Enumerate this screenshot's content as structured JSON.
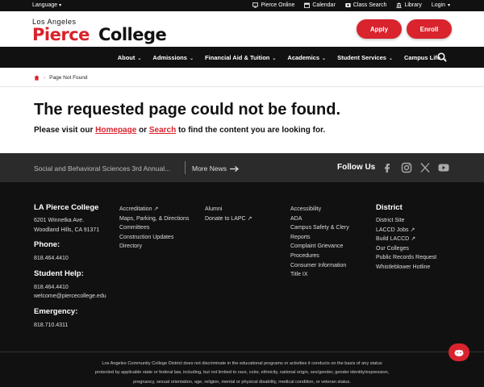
{
  "topbar": {
    "language": "Language",
    "links": [
      {
        "label": "Pierce Online",
        "icon": "monitor-icon"
      },
      {
        "label": "Calendar",
        "icon": "calendar-icon"
      },
      {
        "label": "Class Search",
        "icon": "class-search-icon"
      },
      {
        "label": "Library",
        "icon": "library-icon"
      },
      {
        "label": "Login",
        "icon": "chevron-down-icon"
      }
    ]
  },
  "header": {
    "logo_small": "Los Angeles",
    "logo_pierce": "Pierce",
    "logo_college": "College",
    "apply_label": "Apply",
    "enroll_label": "Enroll"
  },
  "nav": {
    "items": [
      "About",
      "Admissions",
      "Financial Aid & Tuition",
      "Academics",
      "Student Services",
      "Campus Life"
    ]
  },
  "breadcrumb": {
    "current": "Page Not Found"
  },
  "main": {
    "title": "The requested page could not be found.",
    "msg_prefix": "Please visit our ",
    "homepage_link": "Homepage",
    "msg_mid": " or ",
    "search_link": "Search",
    "msg_suffix": " to find the content you are looking for."
  },
  "news": {
    "headline": "Social and Behavioral Sciences 3rd Annual...",
    "more": "More News",
    "follow": "Follow Us"
  },
  "footer": {
    "college": {
      "title": "LA Pierce College",
      "address1": "6201 Winnetka Ave.",
      "address2": "Woodland Hills, CA 91371",
      "phone_title": "Phone:",
      "phone": "818.464.4410",
      "student_help_title": "Student Help:",
      "student_help_phone": "818.464.4410",
      "student_help_email": "welcome@piercecollege.edu",
      "emergency_title": "Emergency:",
      "emergency_phone": "818.710.4311"
    },
    "col2": [
      "Accreditation",
      "Maps, Parking, & Directions",
      "Committees",
      "Construction Updates",
      "Directory"
    ],
    "col3": [
      "Alumni",
      "Donate to LAPC"
    ],
    "col4": [
      "Accessibility",
      "ADA",
      "Campus Safety & Clery",
      "Reports",
      "Complaint Grievance",
      "Procedures",
      "Consumer Information",
      "Title IX"
    ],
    "district": {
      "title": "District",
      "links": [
        "District Site",
        "LACCD Jobs",
        "Build LACCD",
        "Our Colleges",
        "Public Records Request",
        "Whistleblower Hotline"
      ]
    },
    "legal": [
      "Los Angeles Community College District does not discriminate in the educational programs or activities it conducts on the basis of any status",
      "protected by applicable state or federal law, including, but not limited to race, color, ethnicity, national origin, sex/gender, gender identity/expression,",
      "pregnancy, sexual orientation, age, religion, mental or physical disability, medical condition, or veteran status."
    ]
  },
  "colors": {
    "brand_red": "#d9232d",
    "dark": "#111111",
    "strip": "#2b2b2b"
  }
}
